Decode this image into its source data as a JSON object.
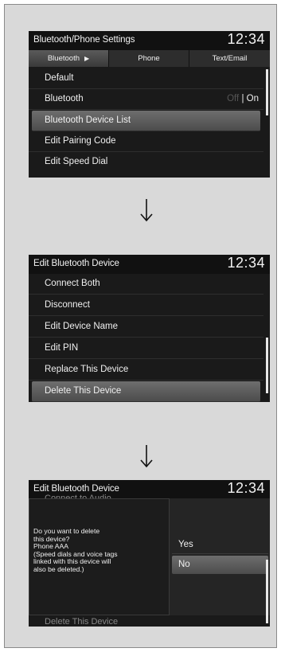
{
  "screen1": {
    "title": "Bluetooth/Phone Settings",
    "clock": "12:34",
    "tabs": [
      "Bluetooth",
      "Phone",
      "Text/Email"
    ],
    "items": [
      "Default",
      "Bluetooth",
      "Bluetooth Device List",
      "Edit Pairing Code",
      "Edit Speed Dial"
    ],
    "toggle_off": "Off",
    "toggle_sep": "|",
    "toggle_on": "On"
  },
  "screen2": {
    "title": "Edit Bluetooth Device",
    "clock": "12:34",
    "items": [
      "Connect Both",
      "Disconnect",
      "Edit Device Name",
      "Edit PIN",
      "Replace This Device",
      "Delete This Device"
    ]
  },
  "screen3": {
    "title": "Edit Bluetooth Device",
    "clock": "12:34",
    "bg_top": "Connect to Audio",
    "bg_bottom": "Delete This Device",
    "dialog_lines": [
      "Do you want to delete",
      "this device?",
      "Phone AAA",
      "(Speed dials and voice tags",
      "linked with this device will",
      "also be deleted.)"
    ],
    "yes": "Yes",
    "no": "No"
  },
  "colors": {
    "panel": "#d9d9d9",
    "screen": "#1a1a1a",
    "highlight": "#5c5c5c"
  }
}
